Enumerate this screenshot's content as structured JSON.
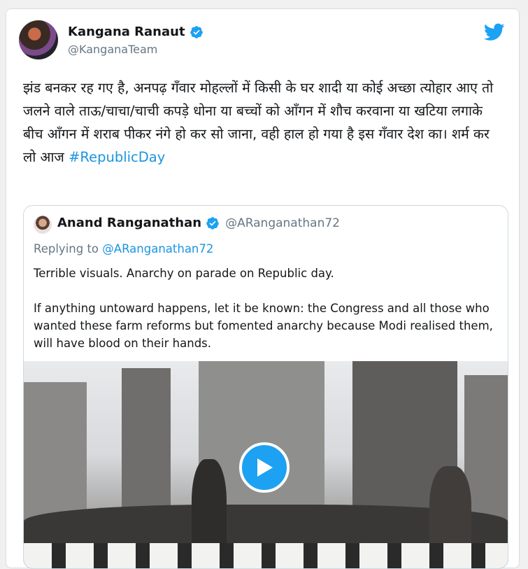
{
  "author": {
    "name": "Kangana Ranaut",
    "handle": "@KanganaTeam"
  },
  "tweet": {
    "text": "झंड बनकर रह गए है, अनपढ़ गँवार मोहल्लों में किसी के घर शादी या कोई अच्छा त्योहार आए तो जलने वाले ताऊ/चाचा/चाची कपड़े धोना या बच्चों को आँगन में शौच करवाना या खटिया लगाके बीच आँगन में शराब पीकर नंगे हो कर सो जाना, वही हाल हो गया है इस गँवार देश का। शर्म कर लो आज ",
    "hashtag": "#RepublicDay"
  },
  "quoted": {
    "name": "Anand Ranganathan",
    "handle": "@ARanganathan72",
    "replying_prefix": "Replying to ",
    "replying_to": "@ARanganathan72",
    "text1": "Terrible visuals. Anarchy on parade on Republic day.",
    "text2": "If anything untoward happens, let it be known: the Congress and all those who wanted these farm reforms but fomented anarchy because Modi realised them, will have blood on their hands."
  },
  "colors": {
    "link": "#1b95e0",
    "verified": "#1da1f2",
    "play": "#1da1f2"
  },
  "icons": [
    "verified-badge-icon",
    "twitter-bird-icon",
    "play-icon"
  ]
}
